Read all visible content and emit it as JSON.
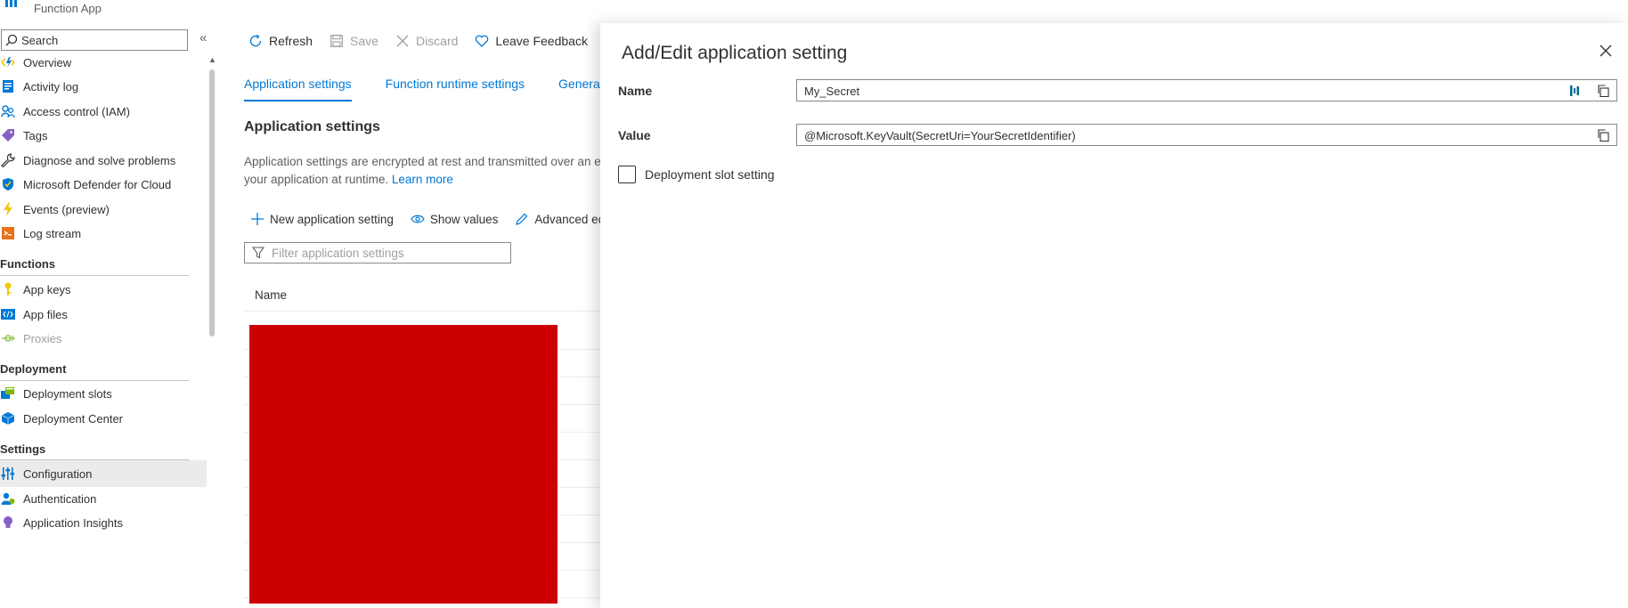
{
  "app": {
    "subtitle": "Function App"
  },
  "leftnav": {
    "search_placeholder": "Search",
    "collapse_glyph": "«",
    "items_top": [
      {
        "label": "Overview",
        "icon": "function-bolt-icon"
      },
      {
        "label": "Activity log",
        "icon": "activity-log-icon"
      },
      {
        "label": "Access control (IAM)",
        "icon": "people-icon"
      },
      {
        "label": "Tags",
        "icon": "tag-icon"
      },
      {
        "label": "Diagnose and solve problems",
        "icon": "wrench-icon"
      },
      {
        "label": "Microsoft Defender for Cloud",
        "icon": "shield-icon"
      },
      {
        "label": "Events (preview)",
        "icon": "lightning-icon"
      },
      {
        "label": "Log stream",
        "icon": "log-stream-icon"
      }
    ],
    "sections": {
      "functions": {
        "title": "Functions",
        "items": [
          {
            "label": "App keys",
            "icon": "key-icon"
          },
          {
            "label": "App files",
            "icon": "code-file-icon"
          },
          {
            "label": "Proxies",
            "icon": "proxy-icon",
            "disabled": true
          }
        ]
      },
      "deployment": {
        "title": "Deployment",
        "items": [
          {
            "label": "Deployment slots",
            "icon": "slots-icon"
          },
          {
            "label": "Deployment Center",
            "icon": "cube-icon"
          }
        ]
      },
      "settings": {
        "title": "Settings",
        "items": [
          {
            "label": "Configuration",
            "icon": "sliders-icon",
            "selected": true
          },
          {
            "label": "Authentication",
            "icon": "user-auth-icon"
          },
          {
            "label": "Application Insights",
            "icon": "lightbulb-icon"
          }
        ]
      }
    }
  },
  "toolbar": {
    "refresh": "Refresh",
    "save": "Save",
    "discard": "Discard",
    "feedback": "Leave Feedback"
  },
  "tabs": [
    "Application settings",
    "Function runtime settings",
    "General settings"
  ],
  "main": {
    "section_title": "Application settings",
    "desc_line1": "Application settings are encrypted at rest and transmitted over an encrypted channel.",
    "desc_line2": "your application at runtime.",
    "learn_more": "Learn more",
    "new_setting": "New application setting",
    "show_values": "Show values",
    "advanced_edit": "Advanced edit",
    "filter_placeholder": "Filter application settings",
    "col_name": "Name"
  },
  "blade": {
    "title": "Add/Edit application setting",
    "name_label": "Name",
    "name_value": "My_Secret",
    "value_label": "Value",
    "value_value": "@Microsoft.KeyVault(SecretUri=YourSecretIdentifier)",
    "slot_setting_label": "Deployment slot setting",
    "slot_setting_checked": false
  },
  "colors": {
    "accent": "#0078d4",
    "redaction": "#cc0000",
    "selected_bg": "#edebe9"
  }
}
